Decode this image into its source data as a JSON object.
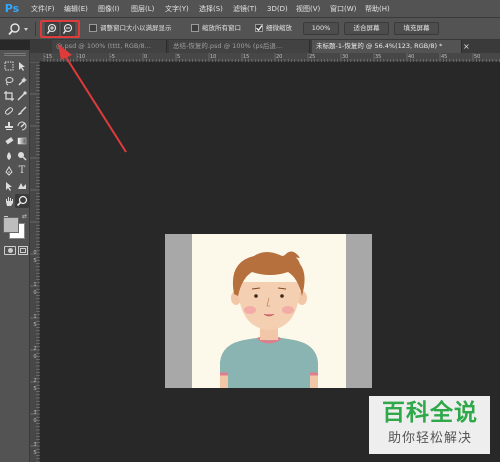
{
  "app": {
    "logo": "Ps"
  },
  "menus": [
    "文件(F)",
    "编辑(E)",
    "图像(I)",
    "图层(L)",
    "文字(Y)",
    "选择(S)",
    "滤镜(T)",
    "3D(D)",
    "视图(V)",
    "窗口(W)",
    "帮助(H)"
  ],
  "options": {
    "resize_windows_label": "调整窗口大小以满屏显示",
    "zoom_all_label": "缩放所有窗口",
    "scrubby_zoom_label": "细微缩放",
    "scrubby_zoom_checked": true,
    "zoom_100_button": "100%",
    "fit_screen_button": "适合屏幕",
    "fill_screen_button": "填充屏幕"
  },
  "tabs": [
    {
      "label": "@.psd @ 100% (tttt, RGB/8...",
      "active": false
    },
    {
      "label": "总结-恢复的.psd @ 100% (ps后退...",
      "active": false
    },
    {
      "label": "未标题-1-恢复的 @ 56.4%(123, RGB/8) *",
      "active": true
    }
  ],
  "ruler_top": [
    "-15",
    "-10",
    "-5",
    "0",
    "5",
    "10",
    "15",
    "20",
    "25",
    "30",
    "35",
    "40",
    "45",
    "50"
  ],
  "ruler_left": [
    "0",
    "5",
    "1",
    "0",
    "1",
    "5",
    "2",
    "0",
    "2",
    "5",
    "3",
    "0",
    "3",
    "5"
  ],
  "watermark": {
    "title": "百科全说",
    "subtitle": "助你轻松解决"
  },
  "colors": {
    "accent_red": "#e03b3b",
    "watermark_green": "#2fa84a",
    "ps_blue": "#31a8ff"
  }
}
